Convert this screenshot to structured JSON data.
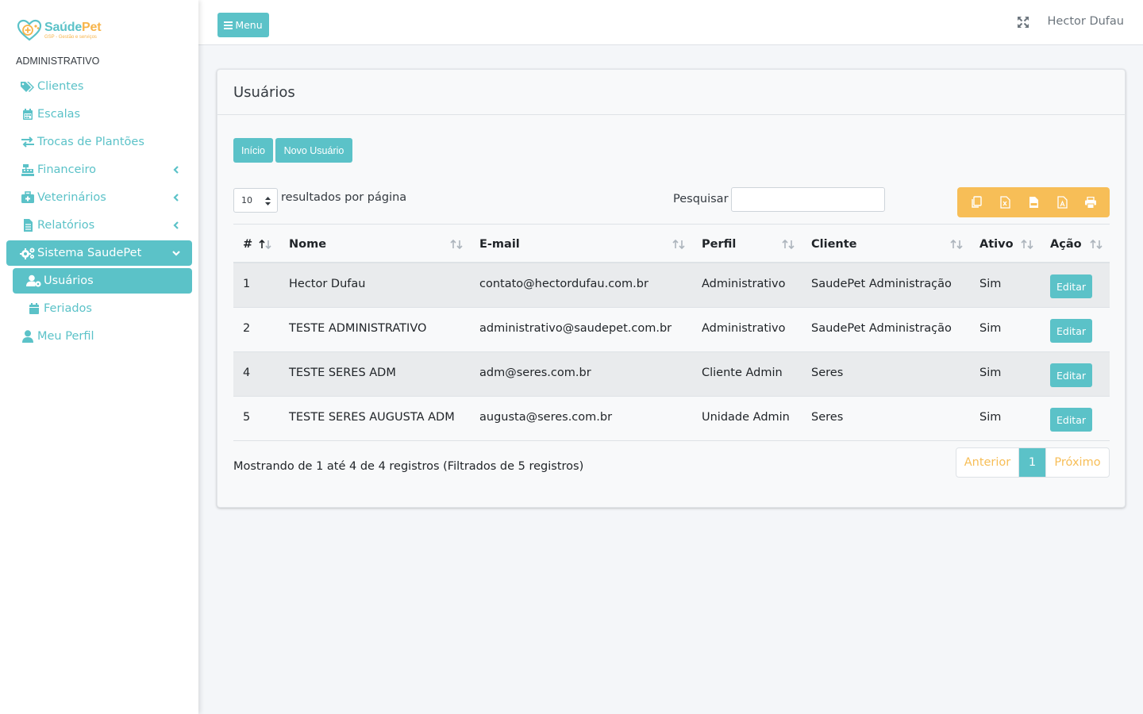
{
  "brand": {
    "name_part1": "Saúde",
    "name_part2": "Pet",
    "tagline": "GSP - Gestão e serviços"
  },
  "sidebar": {
    "header": "ADMINISTRATIVO",
    "items": [
      {
        "label": "Clientes",
        "icon": "tags-icon"
      },
      {
        "label": "Escalas",
        "icon": "calendar-icon"
      },
      {
        "label": "Trocas de Plantões",
        "icon": "exchange-icon"
      },
      {
        "label": "Financeiro",
        "icon": "cash-register-icon",
        "has_children": true
      },
      {
        "label": "Veterinários",
        "icon": "medkit-icon",
        "has_children": true
      },
      {
        "label": "Relatórios",
        "icon": "file-icon",
        "has_children": true
      },
      {
        "label": "Sistema SaudePet",
        "icon": "cogs-icon",
        "expanded": true
      },
      {
        "label": "Usuários",
        "icon": "users-cog-icon",
        "active": true
      },
      {
        "label": "Feriados",
        "icon": "calendar-icon"
      },
      {
        "label": "Meu Perfil",
        "icon": "user-icon"
      }
    ]
  },
  "topbar": {
    "menu_label": "Menu",
    "user_name": "Hector Dufau"
  },
  "page": {
    "title": "Usuários",
    "btn_inicio": "Início",
    "btn_novo": "Novo Usuário",
    "length_value": "10",
    "length_label": "resultados por página",
    "search_label": "Pesquisar",
    "search_value": ""
  },
  "table": {
    "columns": [
      "#",
      "Nome",
      "E-mail",
      "Perfil",
      "Cliente",
      "Ativo",
      "Ação"
    ],
    "rows": [
      {
        "id": "1",
        "nome": "Hector Dufau",
        "email": "contato@hectordufau.com.br",
        "perfil": "Administrativo",
        "cliente": "SaudePet Administração",
        "ativo": "Sim",
        "acao": "Editar"
      },
      {
        "id": "2",
        "nome": "TESTE ADMINISTRATIVO",
        "email": "administrativo@saudepet.com.br",
        "perfil": "Administrativo",
        "cliente": "SaudePet Administração",
        "ativo": "Sim",
        "acao": "Editar"
      },
      {
        "id": "4",
        "nome": "TESTE SERES ADM",
        "email": "adm@seres.com.br",
        "perfil": "Cliente Admin",
        "cliente": "Seres",
        "ativo": "Sim",
        "acao": "Editar"
      },
      {
        "id": "5",
        "nome": "TESTE SERES AUGUSTA ADM",
        "email": "augusta@seres.com.br",
        "perfil": "Unidade Admin",
        "cliente": "Seres",
        "ativo": "Sim",
        "acao": "Editar"
      }
    ]
  },
  "footer": {
    "info": "Mostrando de 1 até 4 de 4 registros (Filtrados de 5 registros)",
    "prev": "Anterior",
    "current": "1",
    "next": "Próximo"
  },
  "colors": {
    "accent": "#5bc2c8",
    "orange": "#f7be57"
  }
}
